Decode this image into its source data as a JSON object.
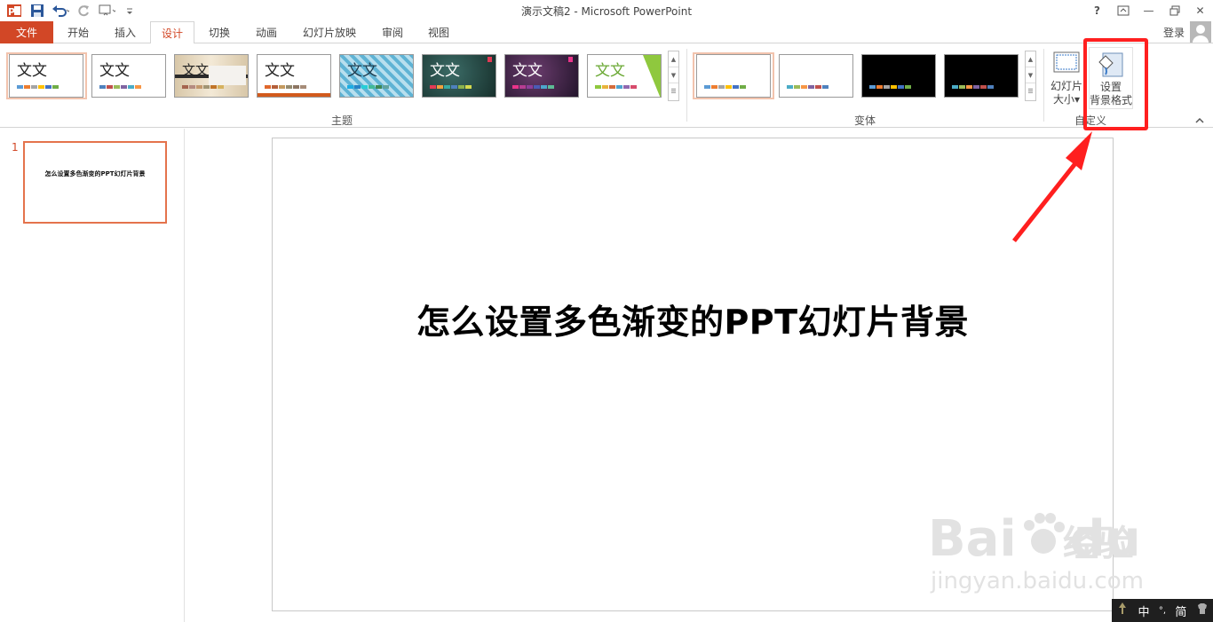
{
  "window": {
    "title": "演示文稿2 - Microsoft PowerPoint",
    "help": "?",
    "ribbon_opts": "⬒",
    "minimize": "—",
    "restore": "🗗",
    "close": "✕"
  },
  "tabs": {
    "file": "文件",
    "items": [
      "开始",
      "插入",
      "设计",
      "切换",
      "动画",
      "幻灯片放映",
      "审阅",
      "视图"
    ],
    "active": "设计",
    "login": "登录"
  },
  "ribbon": {
    "themes_label": "主题",
    "variants_label": "变体",
    "custom_label": "自定义",
    "theme_thumb_text": [
      "文文",
      "文文",
      "文文",
      "文文",
      "文文",
      "文文",
      "文文",
      "文文"
    ],
    "slide_size_line1": "幻灯片",
    "slide_size_line2": "大小",
    "format_bg_line1": "设置",
    "format_bg_line2": "背景格式"
  },
  "slides_pane": {
    "slide_number": "1",
    "thumb_title": "怎么设置多色渐变的PPT幻灯片背景"
  },
  "slide": {
    "title": "怎么设置多色渐变的PPT幻灯片背景"
  },
  "watermark": {
    "brand": "Bai",
    "brand2": "du",
    "cn": "经验",
    "url": "jingyan.baidu.com"
  },
  "ime": {
    "lang": "中",
    "mode": "简"
  },
  "colors": {
    "accent": "#d24726",
    "highlight": "#ff1f1f"
  }
}
